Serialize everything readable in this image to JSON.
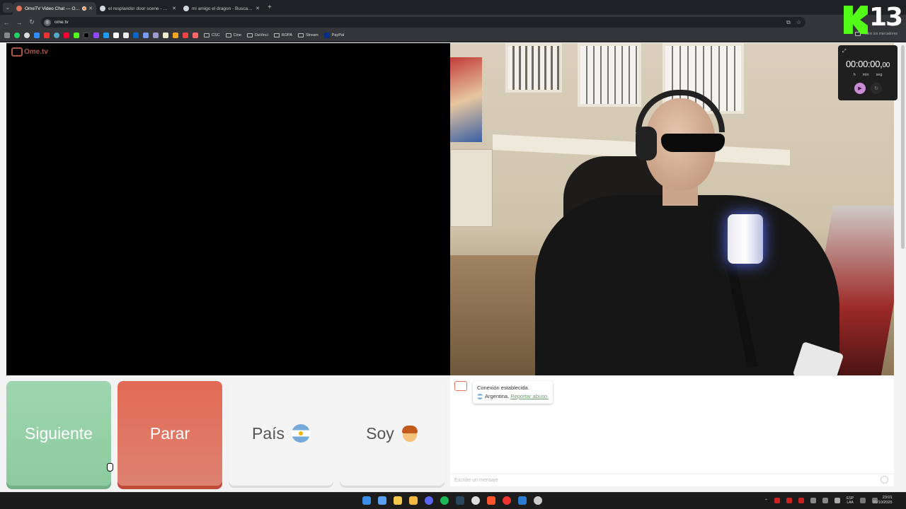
{
  "browser": {
    "tabs": [
      {
        "title": "OmeTV Video Chat — Ome",
        "color": "#e2735e",
        "active": true
      },
      {
        "title": "el resplandor door scene - Busc",
        "color": "#cfd8dc",
        "active": false
      },
      {
        "title": "mi amigo el dragon - Buscar co",
        "color": "#cfd8dc",
        "active": false
      }
    ],
    "new_tab": "+",
    "url": "ome.tv",
    "bookmark_folders": [
      "CSC",
      "Cine",
      "DaVinci",
      "ROPA",
      "Stream"
    ],
    "bookmark_paypal": "PayPal",
    "all_bookmarks": "Todos los marcadores"
  },
  "timer": {
    "value": "00:00:00,",
    "ms": "00",
    "units": [
      "h",
      "min",
      "seg"
    ]
  },
  "buttons": {
    "next": "Siguiente",
    "stop": "Parar",
    "country": "País",
    "gender": "Soy"
  },
  "chat": {
    "status": "Conexión establecida.",
    "country": "Argentina.",
    "report": "Reportar abuso.",
    "placeholder": "Escribe un mensaje"
  },
  "overlay_badge": {
    "number": "13"
  },
  "taskbar": {
    "lang_top": "ESP",
    "lang_bottom": "LAA",
    "time": "23:01",
    "date": "31/10/2025"
  },
  "colors": {
    "next": "#8ccb9f",
    "stop": "#e26a55",
    "brand": "#e2735e",
    "kick_green": "#53fc18"
  }
}
